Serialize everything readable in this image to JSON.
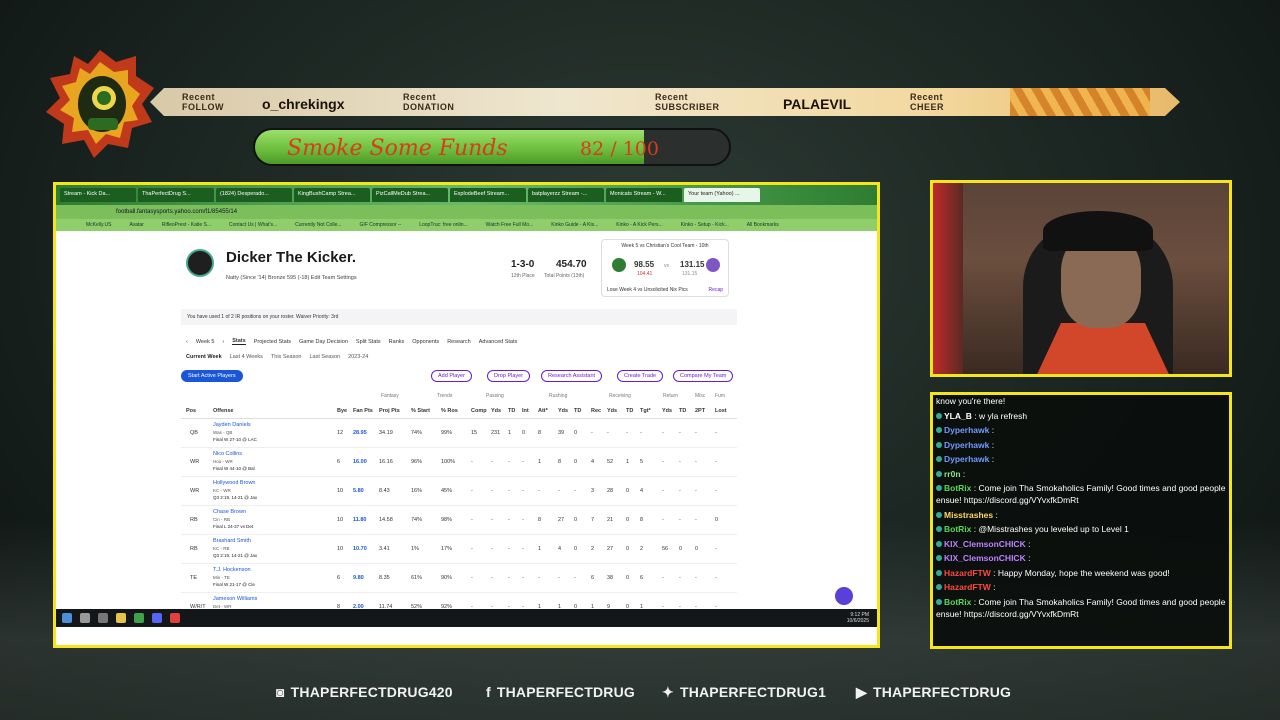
{
  "alerts": {
    "follow": {
      "line1": "Recent",
      "line2": "FOLLOW",
      "value": "o_chrekingx"
    },
    "donation": {
      "line1": "Recent",
      "line2": "DONATION",
      "value": ""
    },
    "subscriber": {
      "line1": "Recent",
      "line2": "SUBSCRIBER",
      "value": "PALAEVIL"
    },
    "cheer": {
      "line1": "Recent",
      "line2": "CHEER",
      "value": ""
    }
  },
  "goal": {
    "title": "Smoke Some Funds",
    "current": "82",
    "sep": "/",
    "target": "100",
    "progress": 0.82
  },
  "browser": {
    "tabs": [
      "Stream - Kick Da...",
      "ThaPerfectDrug S...",
      "(1824) Desperado...",
      "KingBushCamp Strea...",
      "PizCallMeDub Strea...",
      "ExplodeBeef Stream...",
      "batplayerzz Stream -...",
      "Monicats Stream - W...",
      "Your team (Yahoo) ..."
    ],
    "url": "football.fantasysports.yahoo.com/f1/85455/14",
    "bookmarks": [
      "McKelly.US",
      "Avatar",
      "RifleoPrest - Katie S...",
      "Contact Us | What's...",
      "Currently Not Colle...",
      "GIF Compressor --",
      "LoopTruc: free onlin...",
      "Watch Free Full Mo...",
      "Kinko Guide - A Kis...",
      "Kinko - A Kick Pers...",
      "Kinko - Setup - Kick...",
      "All Bookmarks"
    ]
  },
  "team": {
    "name": "Dicker The Kicker.",
    "sub": "Natty (Since '14)    Bronze 595 (-18)    Edit Team Settings",
    "record": "1-3-0",
    "record_sub": "12th Place",
    "points": "454.70",
    "points_sub": "Total Points (13th)"
  },
  "matchup": {
    "title": "Week 5 vs Christian's Cool Team - 10th",
    "my_score": "98.55",
    "my_proj": "104.41",
    "vs": "vs",
    "opp_score": "131.15",
    "opp_proj": "131.15",
    "footer": "Lose Week 4 vs Unsolicited Nix Pics",
    "recap": "Recap"
  },
  "info": "You have used 1 of 2 IR positions on your roster.     Waiver Priority: 3rd",
  "week": {
    "prev": "‹",
    "label": "Week 5",
    "next": "›",
    "tabs": [
      "Stats",
      "Projected Stats",
      "Game Day Decision",
      "Split Stats",
      "Ranks",
      "Opponents",
      "Research",
      "Advanced Stats"
    ]
  },
  "subtabs": [
    "Current Week",
    "Last 4 Weeks",
    "This Season",
    "Last Season",
    "2023-24"
  ],
  "buttons": [
    "Start Active Players",
    "Add Player",
    "Drop Player",
    "Research Assistant",
    "Create Trade",
    "Compare My Team"
  ],
  "groups": [
    "Fantasy",
    "Trends",
    "Passing",
    "Rushing",
    "Receiving",
    "Return",
    "Misc",
    "Fum"
  ],
  "columns": [
    "Pos",
    "Offense",
    "Bye",
    "Fan Pts",
    "Proj Pts",
    "% Start",
    "% Ros",
    "Comp",
    "Yds",
    "TD",
    "Int",
    "Att*",
    "Yds",
    "TD",
    "Rec",
    "Yds",
    "TD",
    "Tgt*",
    "Yds",
    "TD",
    "2PT",
    "Lost"
  ],
  "rows": [
    {
      "pos": "QB",
      "name": "Jayden Daniels",
      "team": "Was - QB",
      "game": "Final W 27-10 @ LAC",
      "bye": "12",
      "fpts": "28.95",
      "proj": "34.19",
      "start": "74%",
      "ros": "99%",
      "cells": [
        "15",
        "231",
        "1",
        "0",
        "8",
        "39",
        "0",
        "-",
        "-",
        "-",
        "-",
        "-",
        "-",
        "-",
        "-"
      ]
    },
    {
      "pos": "WR",
      "name": "Nico Collins",
      "team": "Hou - WR",
      "game": "Final W 44-10 @ Bal",
      "bye": "6",
      "fpts": "16.00",
      "proj": "16.16",
      "start": "96%",
      "ros": "100%",
      "cells": [
        "-",
        "-",
        "-",
        "-",
        "1",
        "8",
        "0",
        "4",
        "52",
        "1",
        "5",
        "-",
        "-",
        "-",
        "-"
      ]
    },
    {
      "pos": "WR",
      "name": "Hollywood Brown",
      "team": "KC - WR",
      "game": "Q3 2:19, 14-21 @ Jax",
      "bye": "10",
      "fpts": "5.80",
      "proj": "8.43",
      "start": "16%",
      "ros": "45%",
      "cells": [
        "-",
        "-",
        "-",
        "-",
        "-",
        "-",
        "-",
        "3",
        "28",
        "0",
        "4",
        "-",
        "-",
        "-",
        "-"
      ]
    },
    {
      "pos": "RB",
      "name": "Chase Brown",
      "team": "Cin - RB",
      "game": "Final L 24-37 vs Det",
      "bye": "10",
      "fpts": "11.80",
      "proj": "14.58",
      "start": "74%",
      "ros": "98%",
      "cells": [
        "-",
        "-",
        "-",
        "-",
        "8",
        "27",
        "0",
        "7",
        "21",
        "0",
        "8",
        "-",
        "-",
        "-",
        "0"
      ]
    },
    {
      "pos": "RB",
      "name": "Brashard Smith",
      "team": "KC - RB",
      "game": "Q3 2:19, 14-21 @ Jax",
      "bye": "10",
      "fpts": "10.70",
      "proj": "3.41",
      "start": "1%",
      "ros": "17%",
      "cells": [
        "-",
        "-",
        "-",
        "-",
        "1",
        "4",
        "0",
        "2",
        "27",
        "0",
        "2",
        "56",
        "0",
        "0",
        "-"
      ]
    },
    {
      "pos": "TE",
      "name": "T.J. Hockenson",
      "team": "Min - TE",
      "game": "Final W 21-17 @ Cle",
      "bye": "6",
      "fpts": "9.80",
      "proj": "8.35",
      "start": "61%",
      "ros": "90%",
      "cells": [
        "-",
        "-",
        "-",
        "-",
        "-",
        "-",
        "-",
        "6",
        "38",
        "0",
        "6",
        "-",
        "-",
        "-",
        "-"
      ]
    },
    {
      "pos": "W/R/T",
      "name": "Jameson Williams",
      "team": "Det - WR",
      "game": "Final W 37-24 @ Cin",
      "bye": "8",
      "fpts": "2.00",
      "proj": "11.74",
      "start": "52%",
      "ros": "92%",
      "cells": [
        "-",
        "-",
        "-",
        "-",
        "1",
        "1",
        "0",
        "1",
        "9",
        "0",
        "1",
        "-",
        "-",
        "-",
        "-"
      ]
    }
  ],
  "clock": {
    "time": "9:12 PM",
    "date": "10/6/2025"
  },
  "chat": [
    {
      "user": "",
      "text": "know you're there!",
      "color": "#ffffff"
    },
    {
      "user": "YLA_B",
      "text": " : w yla refresh",
      "color": "#ffffff"
    },
    {
      "user": "Dyperhawk",
      "text": " :",
      "color": "#6f9bff"
    },
    {
      "user": "Dyperhawk",
      "text": " :",
      "color": "#6f9bff"
    },
    {
      "user": "Dyperhawk",
      "text": " :",
      "color": "#6f9bff"
    },
    {
      "user": "rr0n",
      "text": " :",
      "color": "#8fe08f"
    },
    {
      "user": "BotRix",
      "text": " : Come join Tha Smokaholics Family! Good times and good people ensue! https://discord.gg/VYvxfkDmRt",
      "color": "#58d858"
    },
    {
      "user": "Misstrashes",
      "text": " :",
      "color": "#ffd966"
    },
    {
      "user": "BotRix",
      "text": " : @Misstrashes you leveled up to Level 1",
      "color": "#58d858"
    },
    {
      "user": "KIX_ClemsonCHICK",
      "text": " :",
      "color": "#c080ff"
    },
    {
      "user": "KIX_ClemsonCHICK",
      "text": " :",
      "color": "#c080ff"
    },
    {
      "user": "HazardFTW",
      "text": " : Happy Monday, hope the weekend was good!",
      "color": "#ff4a3a"
    },
    {
      "user": "HazardFTW",
      "text": " :",
      "color": "#ff4a3a"
    },
    {
      "user": "BotRix",
      "text": " : Come join Tha Smokaholics Family! Good times and good people ensue! https://discord.gg/VYvxfkDmRt",
      "color": "#58d858"
    }
  ],
  "socials": [
    {
      "icon": "instagram-icon",
      "glyph": "◙",
      "handle": "THAPERFECTDRUG420"
    },
    {
      "icon": "facebook-icon",
      "glyph": "f",
      "handle": "THAPERFECTDRUG"
    },
    {
      "icon": "twitter-icon",
      "glyph": "✦",
      "handle": "THAPERFECTDRUG1"
    },
    {
      "icon": "youtube-icon",
      "glyph": "▶",
      "handle": "THAPERFECTDRUG"
    }
  ]
}
